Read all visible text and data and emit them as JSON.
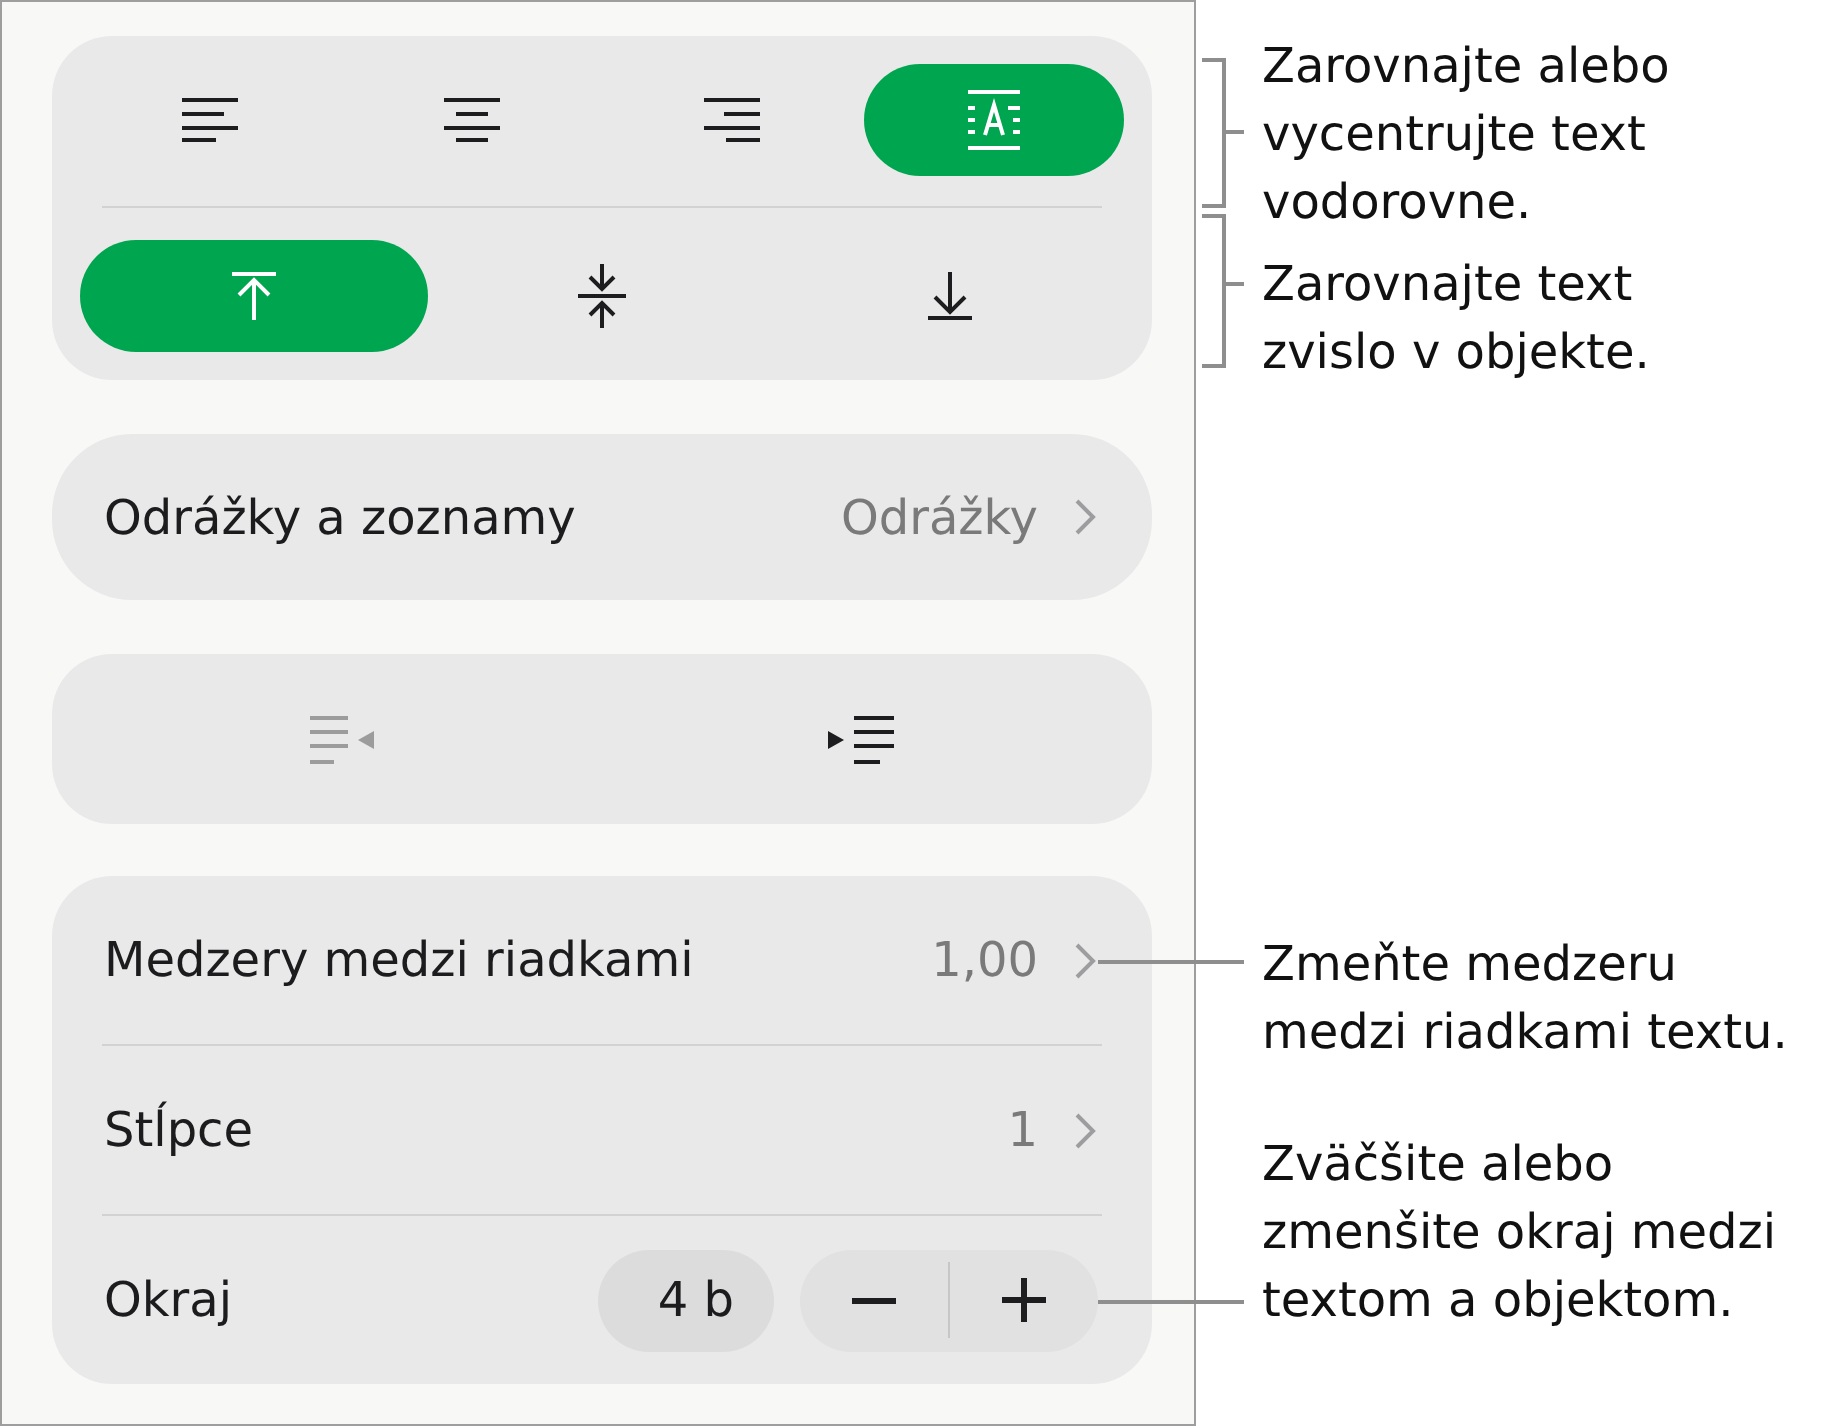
{
  "panel": {
    "alignment": {
      "horizontal": [
        {
          "kind": "left",
          "selected": false
        },
        {
          "kind": "center",
          "selected": false
        },
        {
          "kind": "right",
          "selected": false
        },
        {
          "kind": "auto",
          "selected": true
        }
      ],
      "vertical": [
        {
          "kind": "top",
          "selected": true
        },
        {
          "kind": "middle",
          "selected": false
        },
        {
          "kind": "bottom",
          "selected": false
        }
      ]
    },
    "bullets_row": {
      "label": "Odrážky a zoznamy",
      "value": "Odrážky"
    },
    "indent": [
      {
        "kind": "decrease",
        "disabled": true
      },
      {
        "kind": "increase",
        "disabled": false
      }
    ],
    "spacing_rows": [
      {
        "kind": "disclosure",
        "label": "Medzery medzi riadkami",
        "value": "1,00"
      },
      {
        "kind": "disclosure",
        "label": "Stĺpce",
        "value": "1"
      },
      {
        "kind": "stepper",
        "label": "Okraj",
        "value": "4 b"
      }
    ]
  },
  "callouts": [
    {
      "kind": "bracket",
      "lines": [
        "Zarovnajte alebo",
        "vycentrujte text",
        "vodorovne."
      ]
    },
    {
      "kind": "bracket",
      "lines": [
        "Zarovnajte text",
        "zvislo v objekte."
      ]
    },
    {
      "kind": "leader",
      "lines": [
        "Zmeňte medzeru",
        "medzi riadkami textu."
      ]
    },
    {
      "kind": "leader",
      "lines": [
        "Zväčšite alebo",
        "zmenšite okraj medzi",
        "textom a objektom."
      ]
    }
  ]
}
